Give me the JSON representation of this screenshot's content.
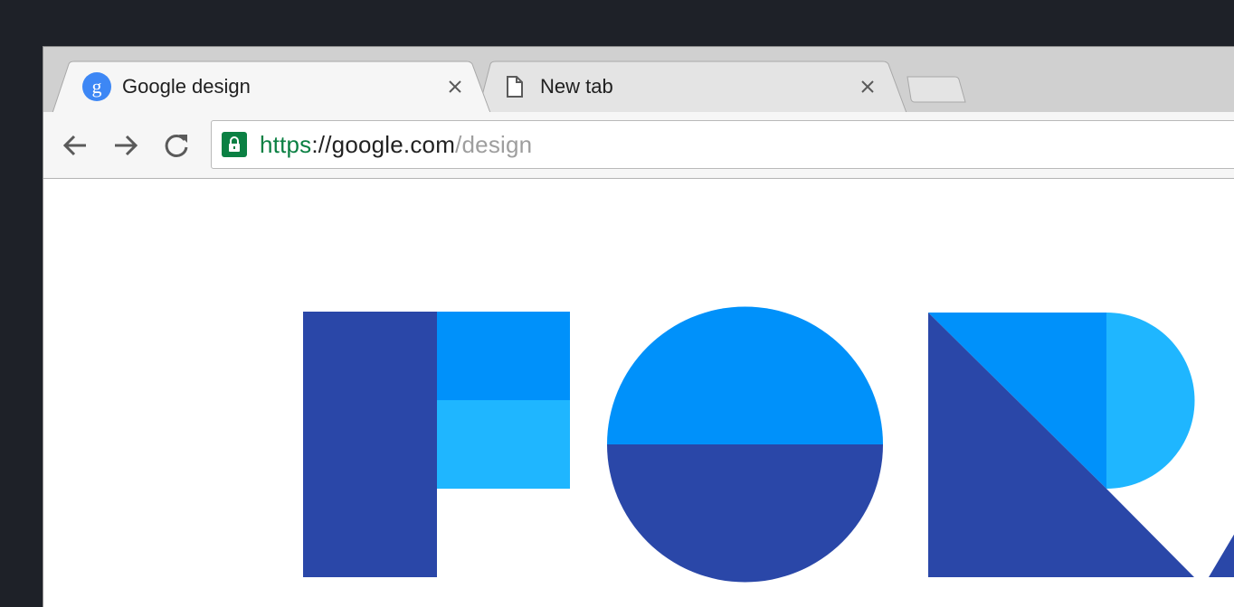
{
  "browser": {
    "tabs": [
      {
        "title": "Google design",
        "favicon": "google-g-icon",
        "active": true
      },
      {
        "title": "New tab",
        "favicon": "page-icon",
        "active": false
      }
    ],
    "new_tab_button": "new-tab-icon"
  },
  "toolbar": {
    "back": "arrow-left-icon",
    "forward": "arrow-right-icon",
    "reload": "reload-icon"
  },
  "omnibox": {
    "secure": true,
    "url_scheme": "https",
    "url_separator": "://",
    "url_host": "google.com",
    "url_path": "/design"
  },
  "colors": {
    "secure_green": "#0b8043",
    "dark_blue": "#2a47a8",
    "blue": "#0091fa",
    "light_blue": "#1fb6ff"
  }
}
